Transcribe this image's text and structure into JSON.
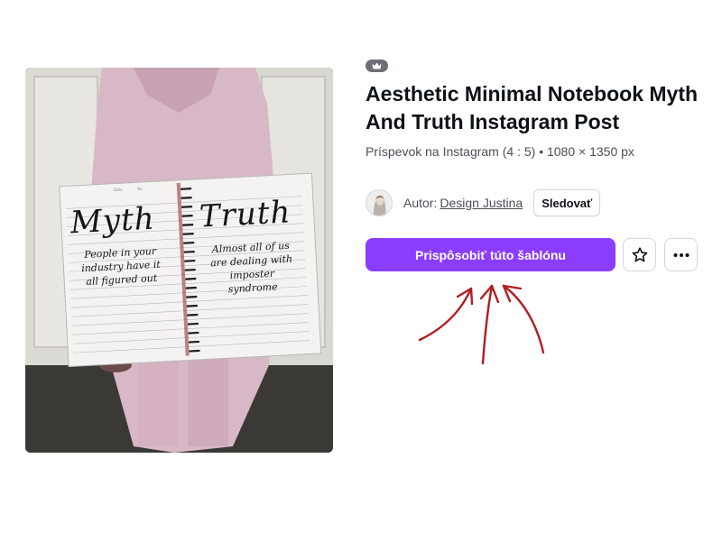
{
  "template": {
    "preview": {
      "notebook": {
        "left_title": "Myth",
        "left_body": "People in your industry have it all figured out",
        "right_title": "Truth",
        "right_body": "Almost all of us are dealing with imposter syndrome",
        "date_label": "Date",
        "no_label": "No."
      }
    },
    "badge_icon": "crown-icon",
    "title": "Aesthetic Minimal Notebook Myth And Truth Instagram Post",
    "subtitle": "Príspevok na Instagram (4 : 5) • 1080 × 1350 px",
    "author": {
      "prefix": "Autor:",
      "name": "Design Justina",
      "follow_label": "Sledovať"
    },
    "actions": {
      "customize_label": "Prispôsobiť túto šablónu",
      "star_icon": "star-icon",
      "more_icon": "more-icon"
    }
  },
  "colors": {
    "primary": "#8b3dff",
    "arrow": "#b01e22",
    "badge": "#6c6f76",
    "text": "#0d1216",
    "muted": "#494f57"
  }
}
